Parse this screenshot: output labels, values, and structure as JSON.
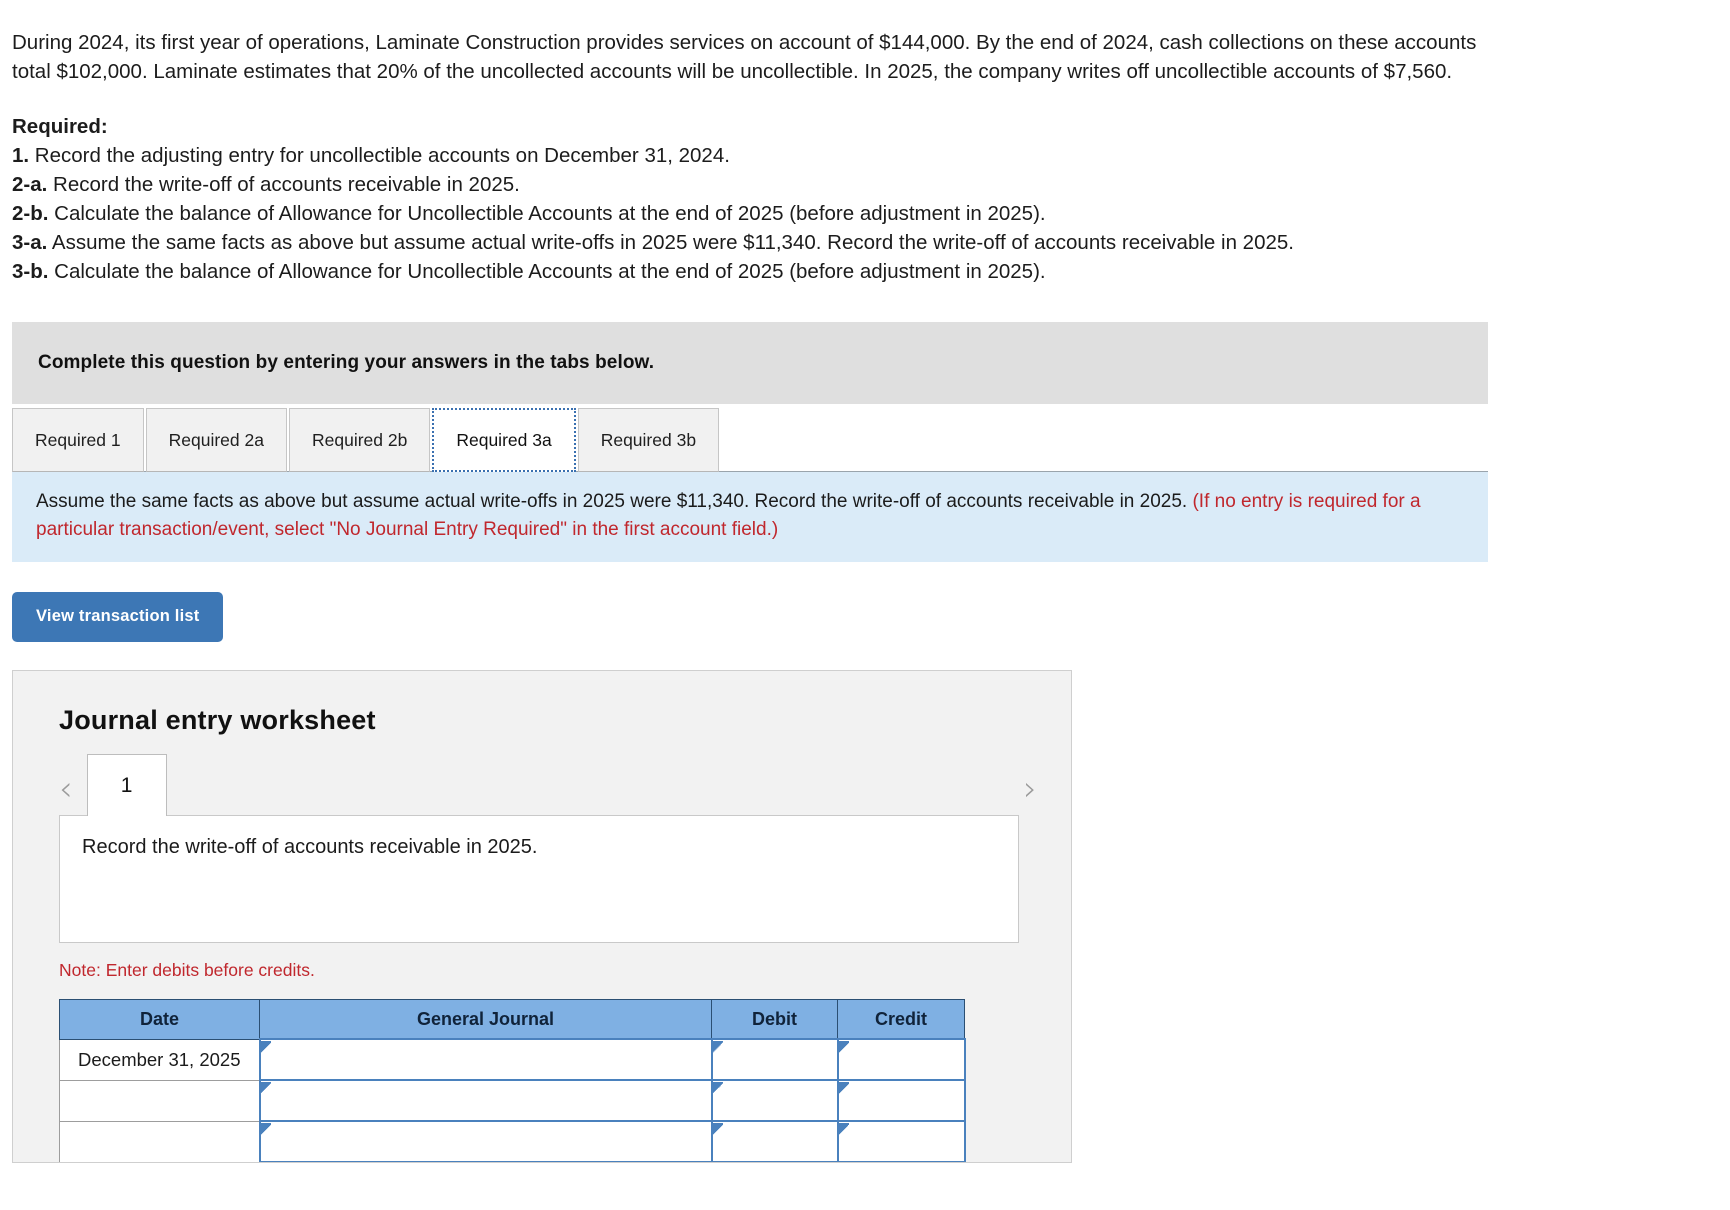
{
  "problem": {
    "text": "During 2024, its first year of operations, Laminate Construction provides services on account of $144,000. By the end of 2024, cash collections on these accounts total $102,000. Laminate estimates that 20% of the uncollected accounts will be uncollectible. In 2025, the company writes off uncollectible accounts of $7,560."
  },
  "required": {
    "title": "Required:",
    "items": [
      {
        "num": "1.",
        "text": " Record the adjusting entry for uncollectible accounts on December 31, 2024."
      },
      {
        "num": "2-a.",
        "text": " Record the write-off of accounts receivable in 2025."
      },
      {
        "num": "2-b.",
        "text": " Calculate the balance of Allowance for Uncollectible Accounts at the end of 2025 (before adjustment in 2025)."
      },
      {
        "num": "3-a.",
        "text": " Assume the same facts as above but assume actual write-offs in 2025 were $11,340. Record the write-off of accounts receivable in 2025."
      },
      {
        "num": "3-b.",
        "text": " Calculate the balance of Allowance for Uncollectible Accounts at the end of 2025 (before adjustment in 2025)."
      }
    ]
  },
  "gray_banner": {
    "text": "Complete this question by entering your answers in the tabs below."
  },
  "tabs": [
    {
      "label": "Required 1",
      "selected": false
    },
    {
      "label": "Required 2a",
      "selected": false
    },
    {
      "label": "Required 2b",
      "selected": false
    },
    {
      "label": "Required 3a",
      "selected": true
    },
    {
      "label": "Required 3b",
      "selected": false
    }
  ],
  "instruction": {
    "main": "Assume the same facts as above but assume actual write-offs in 2025 were $11,340. Record the write-off of accounts receivable in 2025. ",
    "hint": "(If no entry is required for a particular transaction/event, select \"No Journal Entry Required\" in the first account field.)"
  },
  "buttons": {
    "view_transaction_list": "View transaction list"
  },
  "worksheet": {
    "title": "Journal entry worksheet",
    "nav": {
      "prev_icon": "‹",
      "next_icon": "›",
      "current_page": "1"
    },
    "description": "Record the write-off of accounts receivable in 2025.",
    "note": "Note: Enter debits before credits.",
    "table": {
      "headers": [
        "Date",
        "General Journal",
        "Debit",
        "Credit"
      ],
      "rows": [
        {
          "date": "December 31, 2025",
          "general_journal": "",
          "debit": "",
          "credit": ""
        },
        {
          "date": "",
          "general_journal": "",
          "debit": "",
          "credit": ""
        },
        {
          "date": "",
          "general_journal": "",
          "debit": "",
          "credit": ""
        }
      ]
    }
  },
  "colors": {
    "gray_banner": "#DFDFDF",
    "blue_banner": "#DAEBF8",
    "hint_red": "#C0272D",
    "button_blue": "#3D77B5",
    "table_header_blue": "#7FB0E3",
    "input_border_blue": "#4A81BD",
    "tab_selected_border": "#3A70B0"
  }
}
